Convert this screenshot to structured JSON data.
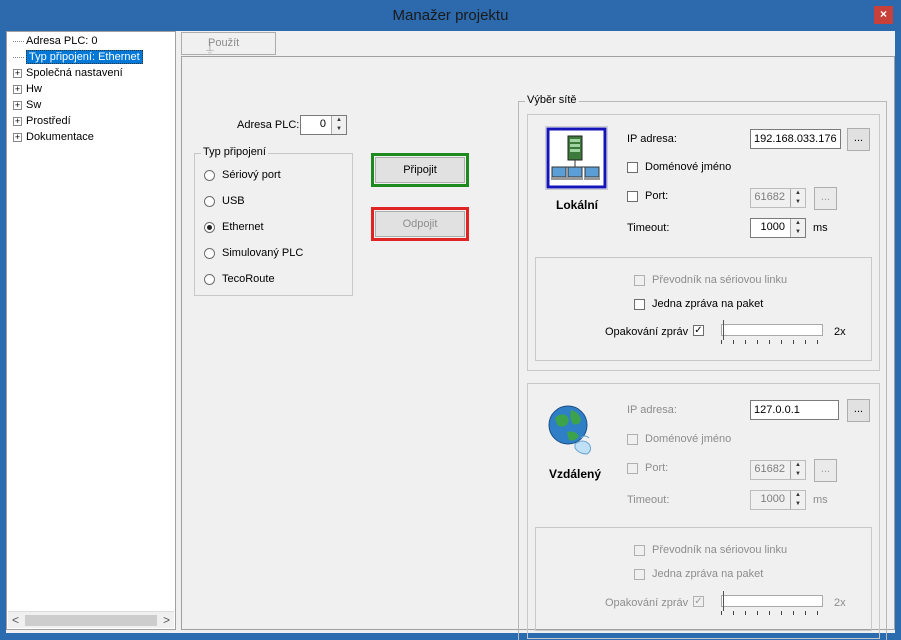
{
  "window": {
    "title": "Manažer projektu",
    "close": "×"
  },
  "tree": {
    "items": [
      {
        "label": "Adresa PLC: 0",
        "expandable": false,
        "selected": false
      },
      {
        "label": "Typ připojení: Ethernet",
        "expandable": false,
        "selected": true
      },
      {
        "label": "Společná nastavení",
        "expandable": true
      },
      {
        "label": "Hw",
        "expandable": true
      },
      {
        "label": "Sw",
        "expandable": true
      },
      {
        "label": "Prostředí",
        "expandable": true
      },
      {
        "label": "Dokumentace",
        "expandable": true
      }
    ],
    "scroll_left": "<",
    "scroll_right": ">"
  },
  "toolbar": {
    "apply_label": "Použít"
  },
  "plc_address": {
    "label": "Adresa PLC:",
    "value": "0"
  },
  "connection_type": {
    "title": "Typ připojení",
    "options": [
      {
        "label": "Sériový port",
        "selected": false
      },
      {
        "label": "USB",
        "selected": false
      },
      {
        "label": "Ethernet",
        "selected": true
      },
      {
        "label": "Simulovaný PLC",
        "selected": false
      },
      {
        "label": "TecoRoute",
        "selected": false
      }
    ]
  },
  "actions": {
    "connect": "Připojit",
    "disconnect": "Odpojit"
  },
  "network": {
    "title": "Výběr sítě",
    "local": {
      "label": "Lokální",
      "ip_label": "IP adresa:",
      "ip_value": "192.168.033.176",
      "domain_label": "Doménové jméno",
      "port_label": "Port:",
      "port_value": "61682",
      "timeout_label": "Timeout:",
      "timeout_value": "1000",
      "timeout_unit": "ms",
      "serial_converter_label": "Převodník na sériovou linku",
      "one_message_label": "Jedna zpráva na paket",
      "repeat_label": "Opakování zpráv",
      "repeat_checked": true,
      "repeat_value": "2x",
      "ellipsis": "..."
    },
    "remote": {
      "label": "Vzdálený",
      "ip_label": "IP adresa:",
      "ip_value": "127.0.0.1",
      "domain_label": "Doménové jméno",
      "port_label": "Port:",
      "port_value": "61682",
      "timeout_label": "Timeout:",
      "timeout_value": "1000",
      "timeout_unit": "ms",
      "serial_converter_label": "Převodník na sériovou linku",
      "one_message_label": "Jedna zpráva na paket",
      "repeat_label": "Opakování zpráv",
      "repeat_checked": true,
      "repeat_value": "2x",
      "ellipsis": "..."
    }
  },
  "colors": {
    "title_bar": "#2c6aad",
    "close_button": "#c7403a",
    "selection": "#0078d7",
    "connect_frame": "#1c8a1c",
    "disconnect_frame": "#e02424"
  }
}
